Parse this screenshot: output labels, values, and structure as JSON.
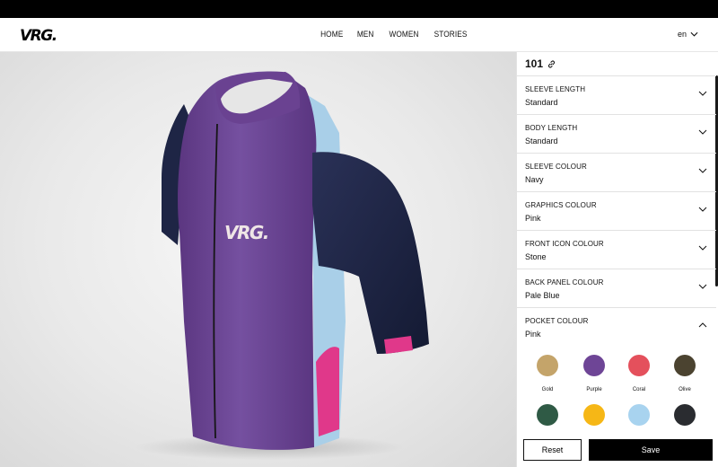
{
  "header": {
    "logo": "VRG.",
    "nav": [
      "HOME",
      "MEN",
      "WOMEN",
      "STORIES"
    ],
    "language": "en"
  },
  "viewer": {
    "jersey_logo": "VRG.",
    "colors": {
      "body": "#6e4596",
      "sleeve": "#1e2545",
      "graphics": "#e0388a",
      "back_panel": "#a9cfe8",
      "collar_inner": "#eeeeee"
    }
  },
  "panel": {
    "design_id": "101",
    "options": [
      {
        "label": "SLEEVE LENGTH",
        "value": "Standard",
        "state": "collapsed"
      },
      {
        "label": "BODY LENGTH",
        "value": "Standard",
        "state": "collapsed"
      },
      {
        "label": "SLEEVE COLOUR",
        "value": "Navy",
        "state": "collapsed"
      },
      {
        "label": "GRAPHICS COLOUR",
        "value": "Pink",
        "state": "collapsed"
      },
      {
        "label": "FRONT ICON COLOUR",
        "value": "Stone",
        "state": "collapsed"
      },
      {
        "label": "BACK PANEL COLOUR",
        "value": "Pale Blue",
        "state": "collapsed"
      },
      {
        "label": "POCKET COLOUR",
        "value": "Pink",
        "state": "expanded"
      }
    ],
    "swatches": [
      {
        "name": "Gold",
        "color": "#c4a46a"
      },
      {
        "name": "Purple",
        "color": "#6e4596"
      },
      {
        "name": "Coral",
        "color": "#e4505c"
      },
      {
        "name": "Olive",
        "color": "#4b4330"
      },
      {
        "name": "",
        "color": "#2f5a45"
      },
      {
        "name": "",
        "color": "#f6b716"
      },
      {
        "name": "",
        "color": "#a8d3ef"
      },
      {
        "name": "",
        "color": "#2a2c30"
      }
    ],
    "reset_label": "Reset",
    "save_label": "Save"
  }
}
